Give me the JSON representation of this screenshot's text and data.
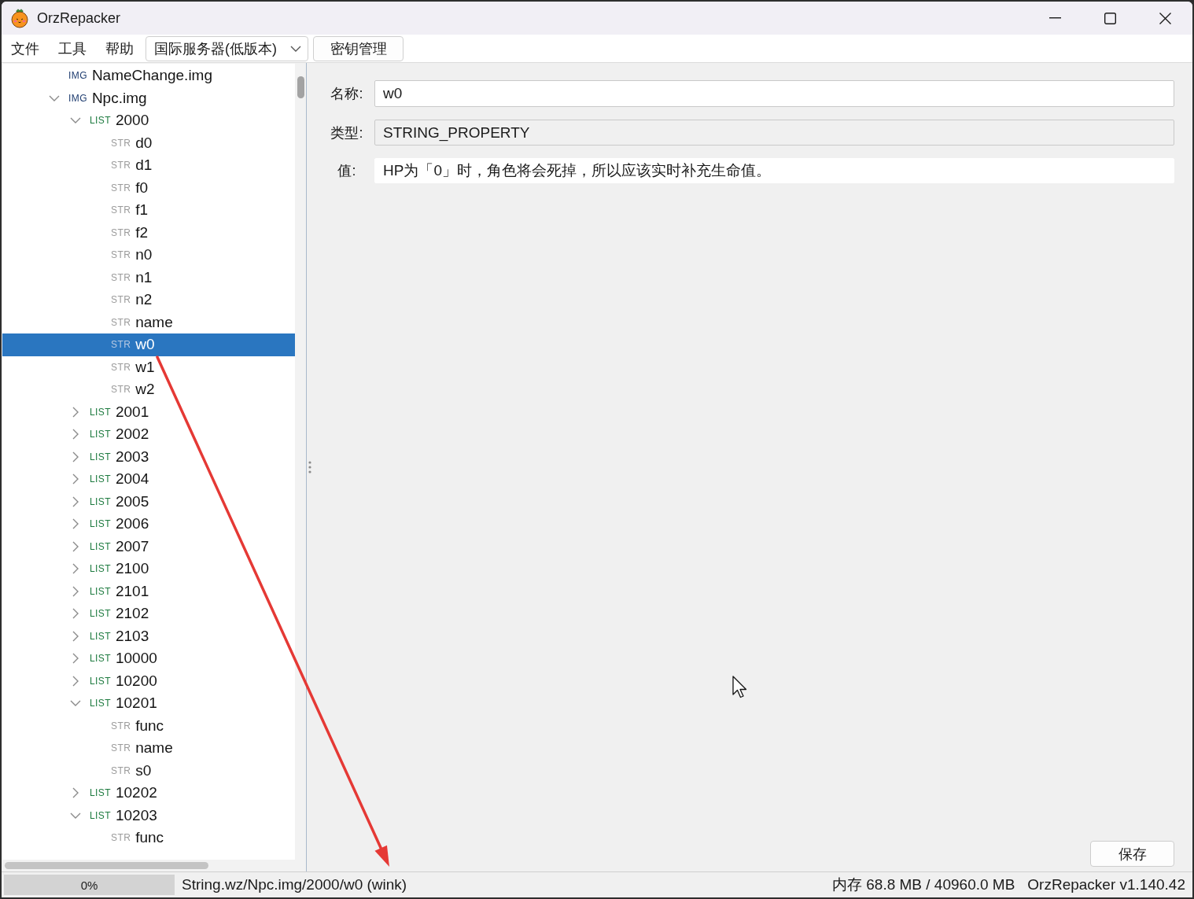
{
  "window": {
    "title": "OrzRepacker"
  },
  "menu": [
    "文件",
    "工具",
    "帮助"
  ],
  "toolbar": {
    "server_select": {
      "value": "国际服务器(低版本)"
    },
    "key_button": "密钥管理"
  },
  "tree": [
    {
      "kind": "img",
      "tag": "IMG",
      "label": "NameChange.img",
      "selected": false
    },
    {
      "kind": "img",
      "tag": "IMG",
      "label": "Npc.img",
      "selected": false,
      "expanded": true,
      "children": [
        {
          "kind": "list",
          "tag": "LIST",
          "label": "2000",
          "selected": false,
          "expanded": true,
          "children": [
            {
              "kind": "str",
              "tag": "STR",
              "label": "d0",
              "selected": false
            },
            {
              "kind": "str",
              "tag": "STR",
              "label": "d1",
              "selected": false
            },
            {
              "kind": "str",
              "tag": "STR",
              "label": "f0",
              "selected": false
            },
            {
              "kind": "str",
              "tag": "STR",
              "label": "f1",
              "selected": false
            },
            {
              "kind": "str",
              "tag": "STR",
              "label": "f2",
              "selected": false
            },
            {
              "kind": "str",
              "tag": "STR",
              "label": "n0",
              "selected": false
            },
            {
              "kind": "str",
              "tag": "STR",
              "label": "n1",
              "selected": false
            },
            {
              "kind": "str",
              "tag": "STR",
              "label": "n2",
              "selected": false
            },
            {
              "kind": "str",
              "tag": "STR",
              "label": "name",
              "selected": false
            },
            {
              "kind": "str",
              "tag": "STR",
              "label": "w0",
              "selected": true
            },
            {
              "kind": "str",
              "tag": "STR",
              "label": "w1",
              "selected": false
            },
            {
              "kind": "str",
              "tag": "STR",
              "label": "w2",
              "selected": false
            }
          ]
        },
        {
          "kind": "list",
          "tag": "LIST",
          "label": "2001",
          "selected": false,
          "expanded": false
        },
        {
          "kind": "list",
          "tag": "LIST",
          "label": "2002",
          "selected": false,
          "expanded": false
        },
        {
          "kind": "list",
          "tag": "LIST",
          "label": "2003",
          "selected": false,
          "expanded": false
        },
        {
          "kind": "list",
          "tag": "LIST",
          "label": "2004",
          "selected": false,
          "expanded": false
        },
        {
          "kind": "list",
          "tag": "LIST",
          "label": "2005",
          "selected": false,
          "expanded": false
        },
        {
          "kind": "list",
          "tag": "LIST",
          "label": "2006",
          "selected": false,
          "expanded": false
        },
        {
          "kind": "list",
          "tag": "LIST",
          "label": "2007",
          "selected": false,
          "expanded": false
        },
        {
          "kind": "list",
          "tag": "LIST",
          "label": "2100",
          "selected": false,
          "expanded": false
        },
        {
          "kind": "list",
          "tag": "LIST",
          "label": "2101",
          "selected": false,
          "expanded": false
        },
        {
          "kind": "list",
          "tag": "LIST",
          "label": "2102",
          "selected": false,
          "expanded": false
        },
        {
          "kind": "list",
          "tag": "LIST",
          "label": "2103",
          "selected": false,
          "expanded": false
        },
        {
          "kind": "list",
          "tag": "LIST",
          "label": "10000",
          "selected": false,
          "expanded": false
        },
        {
          "kind": "list",
          "tag": "LIST",
          "label": "10200",
          "selected": false,
          "expanded": false
        },
        {
          "kind": "list",
          "tag": "LIST",
          "label": "10201",
          "selected": false,
          "expanded": true,
          "children": [
            {
              "kind": "str",
              "tag": "STR",
              "label": "func",
              "selected": false
            },
            {
              "kind": "str",
              "tag": "STR",
              "label": "name",
              "selected": false
            },
            {
              "kind": "str",
              "tag": "STR",
              "label": "s0",
              "selected": false
            }
          ]
        },
        {
          "kind": "list",
          "tag": "LIST",
          "label": "10202",
          "selected": false,
          "expanded": false
        },
        {
          "kind": "list",
          "tag": "LIST",
          "label": "10203",
          "selected": false,
          "expanded": true,
          "children": [
            {
              "kind": "str",
              "tag": "STR",
              "label": "func",
              "selected": false
            }
          ]
        }
      ]
    }
  ],
  "details": {
    "fields": [
      {
        "kind": "input",
        "label": "名称:",
        "value": "w0"
      },
      {
        "kind": "readonly",
        "label": "类型:",
        "value": "STRING_PROPERTY"
      },
      {
        "kind": "text",
        "label": "值:",
        "value": "HP为「0」时，角色将会死掉，所以应该实时补充生命值。"
      }
    ],
    "save_button": "保存"
  },
  "status_bar": {
    "progress": {
      "level": 0,
      "label": "0%"
    },
    "path": "String.wz/Npc.img/2000/w0 (wink)",
    "memory": "内存 68.8 MB / 40960.0 MB",
    "version": "OrzRepacker v1.140.42"
  }
}
